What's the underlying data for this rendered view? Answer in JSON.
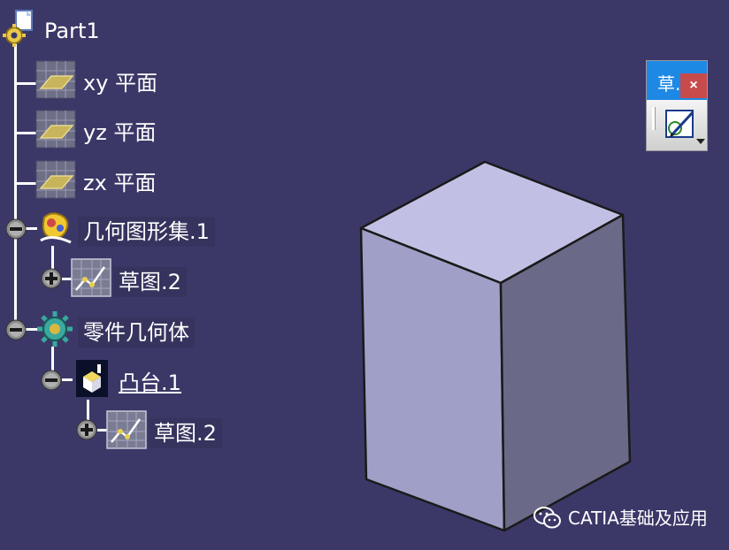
{
  "tree": {
    "root": {
      "label": "Part1",
      "icon": "part-gear-icon"
    },
    "planes": [
      {
        "label": "xy 平面",
        "icon": "plane-icon"
      },
      {
        "label": "yz 平面",
        "icon": "plane-icon"
      },
      {
        "label": "zx 平面",
        "icon": "plane-icon"
      }
    ],
    "geometric_set": {
      "label": "几何图形集.1",
      "icon": "geometric-set-icon",
      "expander": "collapse",
      "children": [
        {
          "label": "草图.2",
          "icon": "sketch-icon",
          "expander": "expand"
        }
      ]
    },
    "part_body": {
      "label": "零件几何体",
      "icon": "part-body-gear-icon",
      "expander": "collapse",
      "children": [
        {
          "label": "凸台.1",
          "icon": "pad-icon",
          "expander": "collapse",
          "children": [
            {
              "label": "草图.2",
              "icon": "sketch-icon",
              "expander": "expand"
            }
          ]
        }
      ]
    }
  },
  "toolbar": {
    "title": "草...",
    "close_label": "×",
    "sketch_button_icon": "sketcher-icon"
  },
  "viewport": {
    "object": "pad-solid",
    "colors": {
      "top": "#c1c0e4",
      "left": "#a09fc7",
      "right": "#6a6987",
      "edge": "#1a1a1a"
    }
  },
  "watermark": {
    "text": "CATIA基础及应用",
    "icon": "wechat-icon"
  },
  "colors": {
    "background": "#3b3868",
    "label_box": "#36345e",
    "toolbar_title": "#1e88e5",
    "close": "#c84b4b"
  }
}
